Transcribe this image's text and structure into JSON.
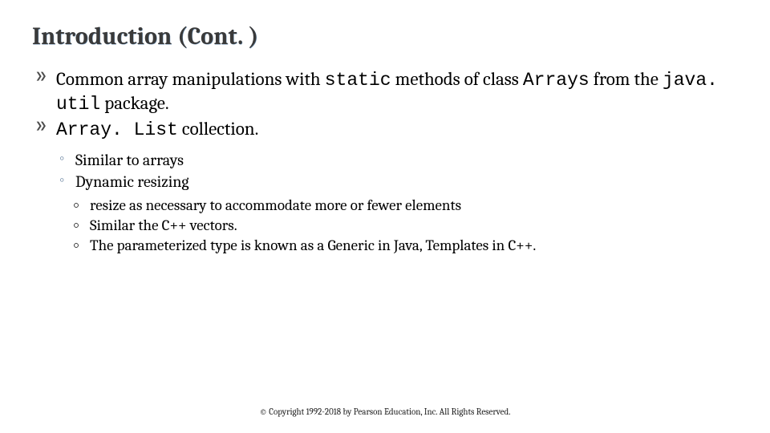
{
  "title": "Introduction (Cont. )",
  "bullets": {
    "b1_pre": "Common array manipulations with ",
    "b1_code1": "static",
    "b1_mid": " methods of class ",
    "b1_code2": "Arrays",
    "b1_post1": " from the ",
    "b1_code3": "java. util",
    "b1_post2": " package.",
    "b2_code": "Array. List",
    "b2_post": " collection."
  },
  "sub": {
    "s1": "Similar to arrays",
    "s2": "Dynamic resizing"
  },
  "subsub": {
    "t1": "resize as necessary to accommodate more or fewer elements",
    "t2": "Similar the C++ vectors.",
    "t3": "The parameterized type is known as a Generic in Java, Templates in C++."
  },
  "footer": "© Copyright 1992-2018 by Pearson Education, Inc. All Rights Reserved."
}
